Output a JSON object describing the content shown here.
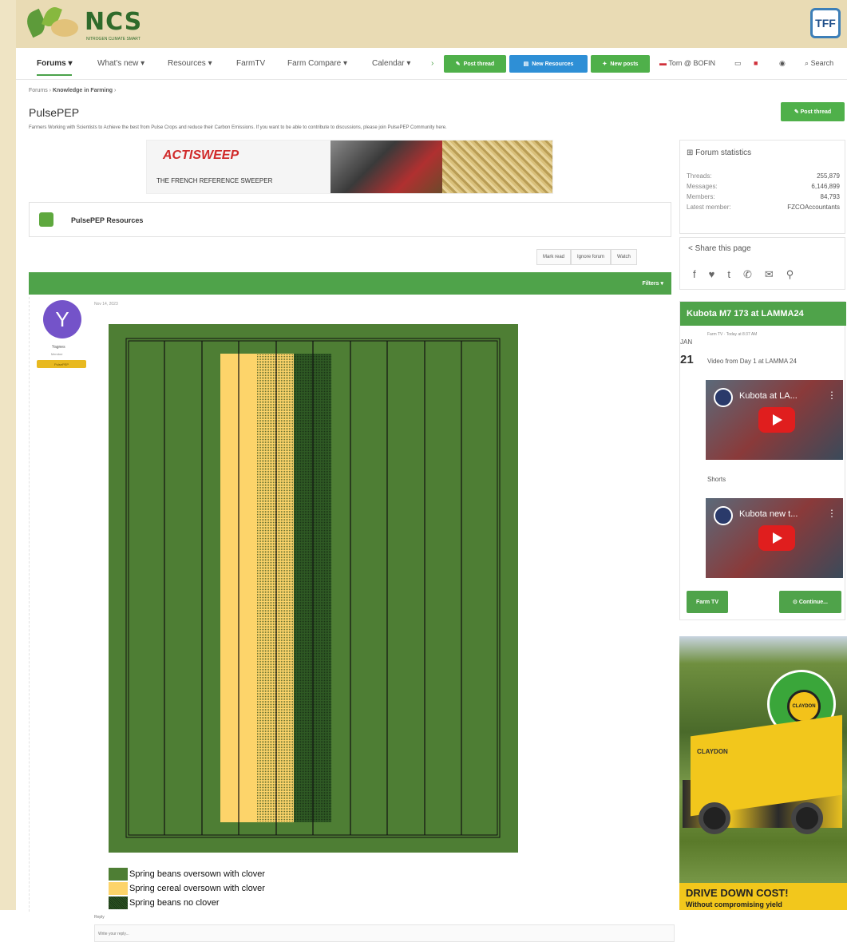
{
  "header": {
    "logo_text": "NCS",
    "logo_subtext": "NITROGEN CLIMATE SMART",
    "user_badge": "TFF"
  },
  "nav": {
    "items": [
      "Forums",
      "What's new",
      "Resources",
      "FarmTV",
      "Farm Compare",
      "Calendar"
    ],
    "post_thread": "Post thread",
    "new_resources": "New Resources",
    "new_posts": "New posts",
    "user": "Tom @ BOFIN",
    "search": "Search"
  },
  "breadcrumb": {
    "root": "Forums",
    "current": "Knowledge in Farming"
  },
  "page": {
    "title": "PulsePEP",
    "description": "Farmers Working with Scientists to Achieve the best from Pulse Crops and reduce their Carbon Emissions. If you want to be able to contribute to discussions, please join PulsePEP Community here.",
    "post_thread": "Post thread"
  },
  "ad_top": {
    "brand_a": "ACTI",
    "brand_b": "SWEEP",
    "tagline": "THE FRENCH REFERENCE SWEEPER"
  },
  "resources": {
    "label": "PulsePEP Resources"
  },
  "actions": {
    "mark_read": "Mark read",
    "ignore": "Ignore forum",
    "watch": "Watch"
  },
  "filters": "Filters",
  "post": {
    "date": "Nov 14, 2023",
    "author_initial": "Y",
    "author_name": "Yagnes",
    "author_role": "Member",
    "author_badge": "PulsePEP"
  },
  "legend": {
    "item1": "Spring beans oversown with clover",
    "item2": "Spring cereal oversown with clover",
    "item3": "Spring beans no clover"
  },
  "reply": {
    "label": "Reply",
    "placeholder": "Write your reply..."
  },
  "colors": {
    "field_green": "#4e7e34",
    "cereal_yellow": "#fdd46a",
    "brand_green": "#4fa34a"
  },
  "stats": {
    "title": "Forum statistics",
    "threads_label": "Threads:",
    "threads": "255,879",
    "messages_label": "Messages:",
    "messages": "6,146,899",
    "members_label": "Members:",
    "members": "84,793",
    "latest_label": "Latest member:",
    "latest": "FZCOAccountants"
  },
  "share": {
    "title": "Share this page"
  },
  "kubota": {
    "title": "Kubota M7 173 at LAMMA24",
    "meta": "Farm TV · Today at 8:37 AM",
    "month": "JAN",
    "day": "21",
    "video_title": "Video from Day 1 at LAMMA 24",
    "video1": "Kubota at LA...",
    "shorts": "Shorts",
    "video2": "Kubota new t...",
    "farm_tv": "Farm TV",
    "continue": "Continue..."
  },
  "claydon": {
    "badge": "CLAYDON",
    "machine_label": "CLAYDON",
    "cta": "DRIVE DOWN COST!",
    "cta_sub": "Without compromising yield"
  }
}
